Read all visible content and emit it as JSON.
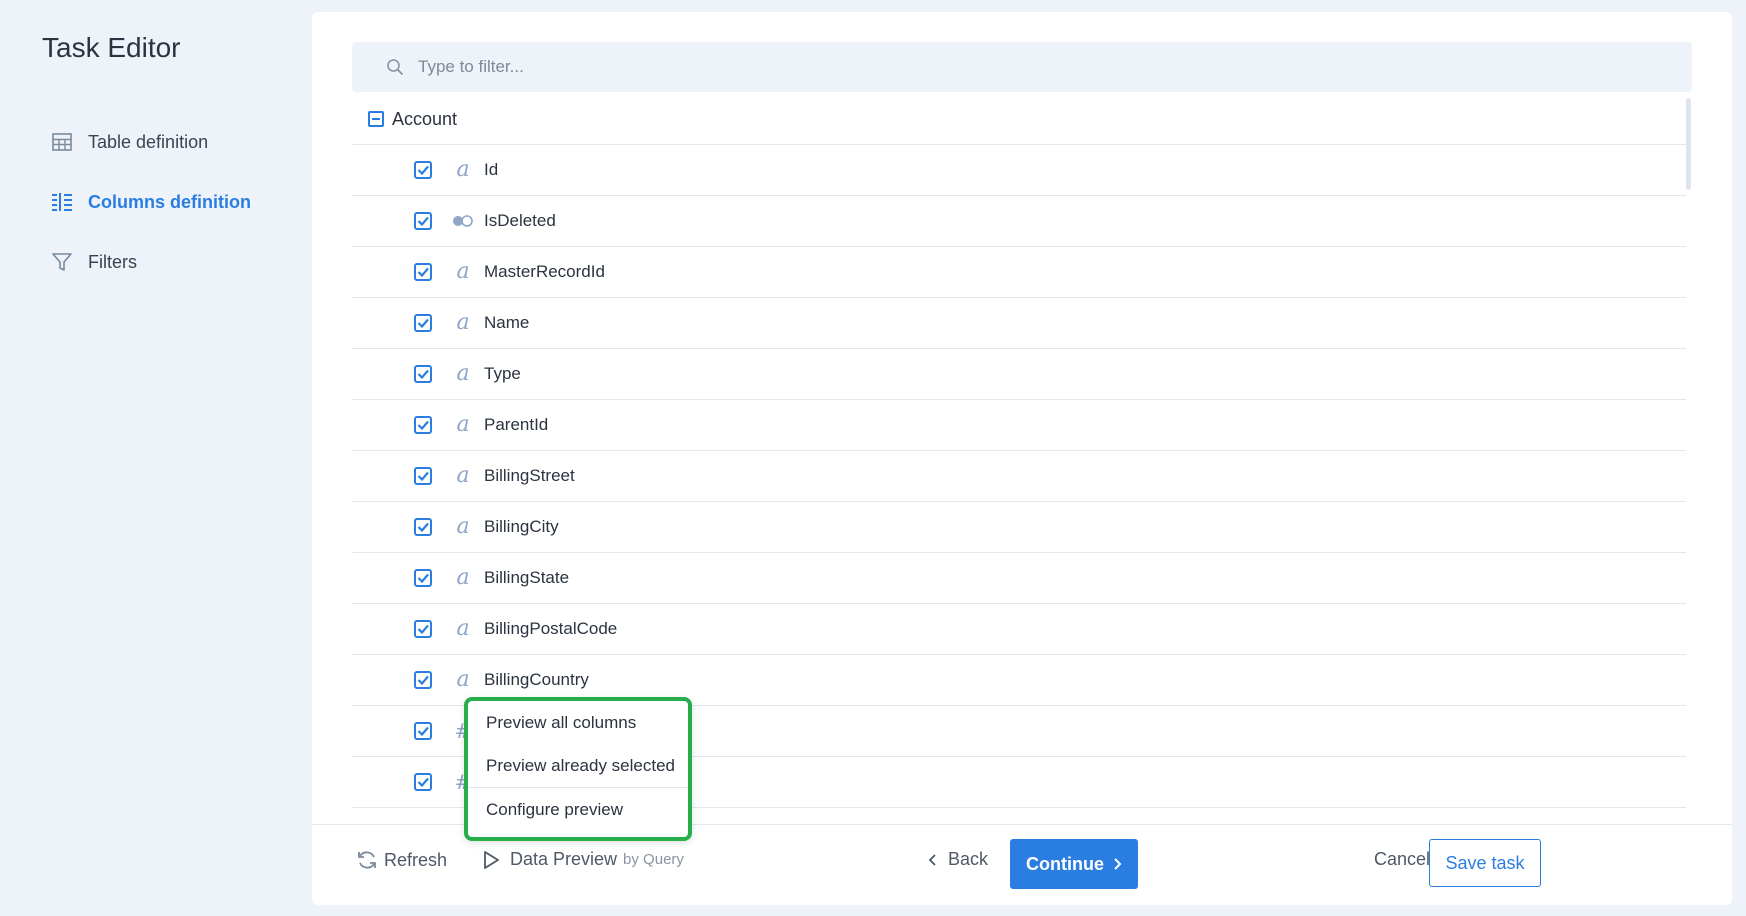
{
  "app": {
    "title": "Task Editor"
  },
  "sidebar": {
    "items": [
      {
        "label": "Table definition",
        "icon": "table-icon",
        "active": false
      },
      {
        "label": "Columns definition",
        "icon": "columns-icon",
        "active": true
      },
      {
        "label": "Filters",
        "icon": "filter-icon",
        "active": false
      }
    ]
  },
  "filter": {
    "placeholder": "Type to filter...",
    "value": ""
  },
  "tree": {
    "group": {
      "name": "Account",
      "expanded": true
    },
    "columns": [
      {
        "name": "Id",
        "type": "text",
        "checked": true
      },
      {
        "name": "IsDeleted",
        "type": "boolean",
        "checked": true
      },
      {
        "name": "MasterRecordId",
        "type": "text",
        "checked": true
      },
      {
        "name": "Name",
        "type": "text",
        "checked": true
      },
      {
        "name": "Type",
        "type": "text",
        "checked": true
      },
      {
        "name": "ParentId",
        "type": "text",
        "checked": true
      },
      {
        "name": "BillingStreet",
        "type": "text",
        "checked": true
      },
      {
        "name": "BillingCity",
        "type": "text",
        "checked": true
      },
      {
        "name": "BillingState",
        "type": "text",
        "checked": true
      },
      {
        "name": "BillingPostalCode",
        "type": "text",
        "checked": true
      },
      {
        "name": "BillingCountry",
        "type": "text",
        "checked": true
      },
      {
        "name": "",
        "type": "number",
        "checked": true
      },
      {
        "name": "",
        "type": "number",
        "checked": true
      }
    ]
  },
  "popup": {
    "items": [
      {
        "label": "Preview all columns"
      },
      {
        "label": "Preview already selected"
      },
      {
        "label": "Configure preview"
      }
    ]
  },
  "footer": {
    "refresh_label": "Refresh",
    "preview_label": "Data Preview",
    "preview_sub": "by Query",
    "back_label": "Back",
    "continue_label": "Continue",
    "cancel_label": "Cancel",
    "save_label": "Save task"
  },
  "colors": {
    "accent": "#2a7de1",
    "popup_border": "#27ae4a",
    "background": "#eef3fa"
  }
}
